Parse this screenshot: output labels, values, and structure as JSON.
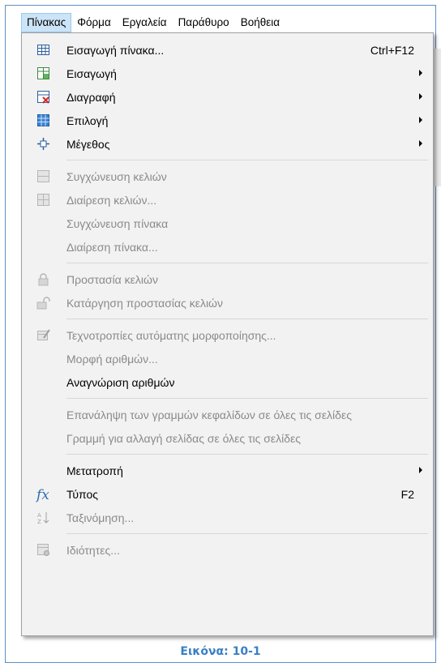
{
  "menubar": {
    "items": [
      "Πίνακας",
      "Φόρμα",
      "Εργαλεία",
      "Παράθυρο",
      "Βοήθεια"
    ]
  },
  "menu": {
    "items": [
      {
        "label": "Εισαγωγή πίνακα...",
        "shortcut": "Ctrl+F12",
        "icon": "table-insert-icon",
        "disabled": false
      },
      {
        "label": "Εισαγωγή",
        "icon": "insert-cells-icon",
        "submenu": true,
        "disabled": false
      },
      {
        "label": "Διαγραφή",
        "icon": "delete-cells-icon",
        "submenu": true,
        "disabled": false
      },
      {
        "label": "Επιλογή",
        "icon": "select-table-icon",
        "submenu": true,
        "disabled": false
      },
      {
        "label": "Μέγεθος",
        "icon": "resize-icon",
        "submenu": true,
        "disabled": false
      },
      {
        "label": "Συγχώνευση κελιών",
        "icon": "merge-cells-icon",
        "disabled": true
      },
      {
        "label": "Διαίρεση κελιών...",
        "icon": "split-cells-icon",
        "disabled": true
      },
      {
        "label": "Συγχώνευση πίνακα",
        "disabled": true
      },
      {
        "label": "Διαίρεση πίνακα...",
        "disabled": true
      },
      {
        "label": "Προστασία κελιών",
        "icon": "lock-icon",
        "disabled": true
      },
      {
        "label": "Κατάργηση προστασίας κελιών",
        "icon": "unlock-icon",
        "disabled": true
      },
      {
        "label": "Τεχνοτροπίες αυτόματης μορφοποίησης...",
        "icon": "autoformat-icon",
        "disabled": true
      },
      {
        "label": "Μορφή αριθμών...",
        "disabled": true
      },
      {
        "label": "Αναγνώριση αριθμών",
        "disabled": false
      },
      {
        "label": "Επανάληψη των γραμμών κεφαλίδων σε όλες τις σελίδες",
        "disabled": true
      },
      {
        "label": "Γραμμή για αλλαγή σελίδας σε όλες τις σελίδες",
        "disabled": true
      },
      {
        "label": "Μετατροπή",
        "submenu": true,
        "disabled": false
      },
      {
        "label": "Τύπος",
        "shortcut": "F2",
        "icon": "fx-icon",
        "icon_glyph": "fx",
        "disabled": false
      },
      {
        "label": "Ταξινόμηση...",
        "icon": "sort-icon",
        "disabled": true
      },
      {
        "label": "Ιδιότητες...",
        "icon": "table-properties-icon",
        "disabled": true
      }
    ]
  },
  "caption": "Εικόνα: 10-1",
  "colors": {
    "accent": "#3a7fc4",
    "menubar_active": "#cce4f7",
    "menu_bg": "#f2f2f2",
    "disabled_text": "#8a8a8a"
  }
}
